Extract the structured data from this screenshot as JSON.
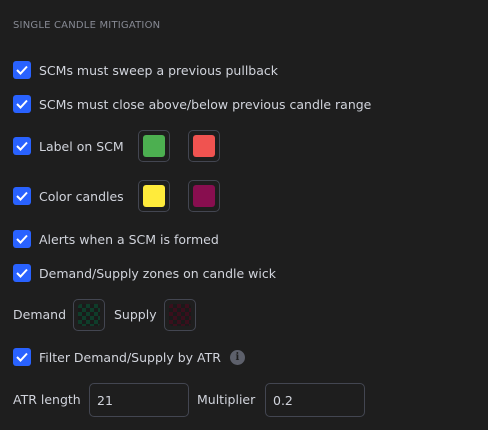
{
  "section": {
    "title": "SINGLE CANDLE MITIGATION"
  },
  "options": {
    "sweep": {
      "label": "SCMs must sweep a previous pullback",
      "checked": true
    },
    "close_range": {
      "label": "SCMs must close above/below previous candle range",
      "checked": true
    },
    "label_on_scm": {
      "label": "Label on SCM",
      "checked": true,
      "color_bull": "#4caf50",
      "color_bear": "#f05350"
    },
    "color_candles": {
      "label": "Color candles",
      "checked": true,
      "color_bull": "#ffeb3b",
      "color_bear": "#880e4f"
    },
    "alerts": {
      "label": "Alerts when a SCM is formed",
      "checked": true
    },
    "zones_on_wick": {
      "label": "Demand/Supply zones on candle wick",
      "checked": true
    },
    "filter_atr": {
      "label": "Filter Demand/Supply by ATR",
      "checked": true,
      "info_icon": "info-icon"
    }
  },
  "zones": {
    "demand_label": "Demand",
    "demand_color": "#0f3d2a",
    "supply_label": "Supply",
    "supply_color": "#3a0f1c"
  },
  "atr": {
    "length_label": "ATR length",
    "length_value": "21",
    "multiplier_label": "Multiplier",
    "multiplier_value": "0.2"
  },
  "theme": {
    "checkbox_color": "#2962ff",
    "background": "#1e1e1e"
  }
}
